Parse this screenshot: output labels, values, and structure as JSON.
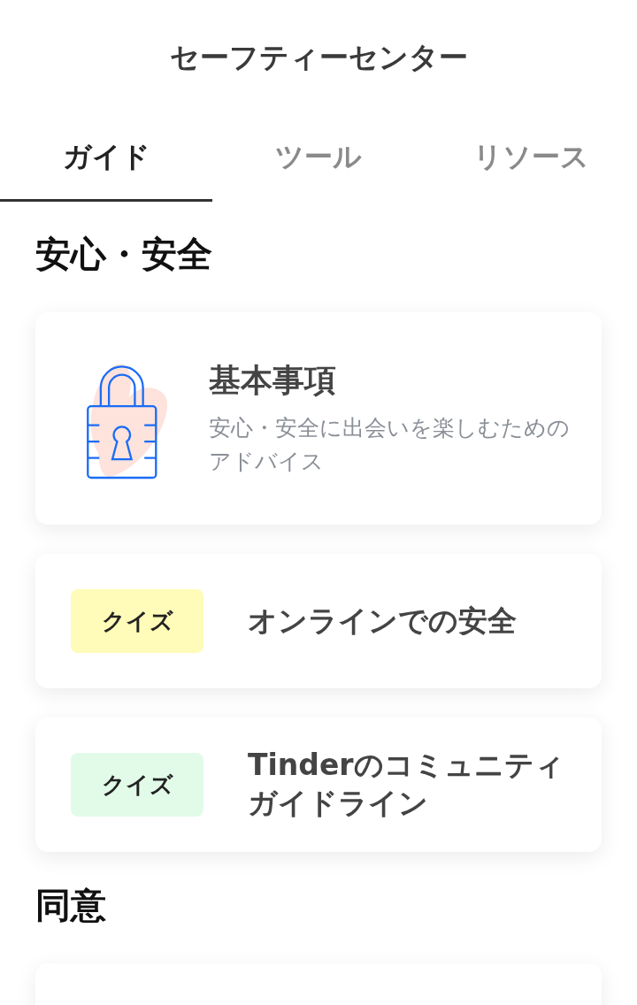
{
  "header": {
    "title": "セーフティーセンター"
  },
  "tabs": [
    {
      "label": "ガイド",
      "selected": true
    },
    {
      "label": "ツール",
      "selected": false
    },
    {
      "label": "リソース",
      "selected": false
    }
  ],
  "sections": [
    {
      "heading": "安心・安全",
      "cards": [
        {
          "kind": "feature",
          "title": "基本事項",
          "description": "安心・安全に出会いを楽しむためのアドバイス"
        },
        {
          "kind": "quiz",
          "tag": "クイズ",
          "color": "#fffbb8",
          "title": "オンラインでの安全"
        },
        {
          "kind": "quiz",
          "tag": "クイズ",
          "color": "#e2fbe9",
          "title": "Tinderのコミュニティガイドライン"
        }
      ]
    },
    {
      "heading": "同意",
      "cards": [
        {
          "kind": "more"
        }
      ]
    }
  ]
}
